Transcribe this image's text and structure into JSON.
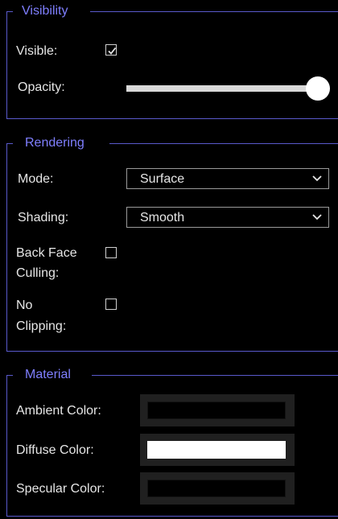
{
  "visibility": {
    "title": "Visibility",
    "visible_label": "Visible:",
    "visible_checked": true,
    "opacity_label": "Opacity:",
    "opacity_value": 1.0
  },
  "rendering": {
    "title": "Rendering",
    "mode_label": "Mode:",
    "mode_value": "Surface",
    "shading_label": "Shading:",
    "shading_value": "Smooth",
    "back_face_label_1": "Back Face",
    "back_face_label_2": "Culling:",
    "back_face_checked": false,
    "no_clipping_label_1": "No",
    "no_clipping_label_2": "Clipping:",
    "no_clipping_checked": false
  },
  "material": {
    "title": "Material",
    "ambient_label": "Ambient Color:",
    "ambient_color": "#000000",
    "diffuse_label": "Diffuse Color:",
    "diffuse_color": "#ffffff",
    "specular_label": "Specular Color:",
    "specular_color": "#000000"
  },
  "colors": {
    "accent": "#7f7fff",
    "frame": "#5a5acc",
    "background": "#000000"
  },
  "icons": {
    "check": "checkmark-icon",
    "dropdown": "chevron-down-icon"
  }
}
